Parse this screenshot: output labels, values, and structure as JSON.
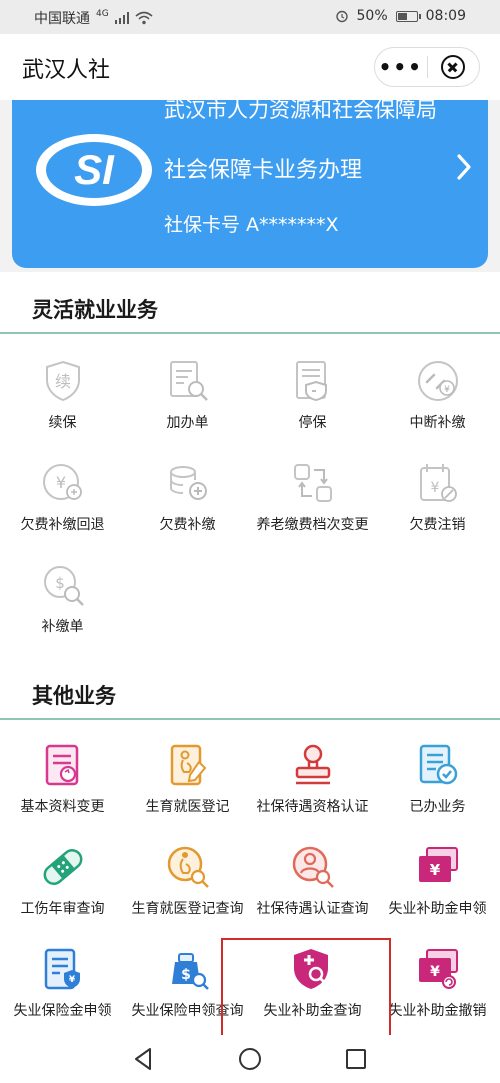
{
  "status_bar": {
    "carrier": "中国联通",
    "network": "4G",
    "battery": "50%",
    "time": "08:09"
  },
  "title_bar": {
    "title": "武汉人社",
    "more_label": "•••"
  },
  "card": {
    "org": "武汉市人力资源和社会保障局",
    "service": "社会保障卡业务办理",
    "card_number": "社保卡号 A*******X",
    "brand_color": "#3d9df0"
  },
  "flexible": {
    "title": "灵活就业业务",
    "items": [
      {
        "label": "续保",
        "icon": "renew-shield-icon"
      },
      {
        "label": "加办单",
        "icon": "form-search-icon"
      },
      {
        "label": "停保",
        "icon": "stop-insurance-doc-icon"
      },
      {
        "label": "中断补缴",
        "icon": "broken-chain-yuan-icon"
      },
      {
        "label": "欠费补缴回退",
        "icon": "yuan-refund-icon"
      },
      {
        "label": "欠费补缴",
        "icon": "coins-add-icon"
      },
      {
        "label": "养老缴费档次变更",
        "icon": "switch-arrows-icon"
      },
      {
        "label": "欠费注销",
        "icon": "calendar-yuan-cancel-icon"
      },
      {
        "label": "补缴单",
        "icon": "dollar-search-icon"
      }
    ]
  },
  "other": {
    "title": "其他业务",
    "items": [
      {
        "label": "基本资料变更",
        "icon": "profile-refresh-icon"
      },
      {
        "label": "生育就医登记",
        "icon": "pregnancy-pen-icon"
      },
      {
        "label": "社保待遇资格认证",
        "icon": "stamp-icon"
      },
      {
        "label": "已办业务",
        "icon": "doc-check-icon"
      },
      {
        "label": "工伤年审查询",
        "icon": "bandage-icon"
      },
      {
        "label": "生育就医登记查询",
        "icon": "pregnancy-search-icon"
      },
      {
        "label": "社保待遇认证查询",
        "icon": "person-search-icon"
      },
      {
        "label": "失业补助金申领",
        "icon": "yuan-cards-icon"
      },
      {
        "label": "失业保险金申领",
        "icon": "yuan-form-icon"
      },
      {
        "label": "失业保险申领查询",
        "icon": "money-bag-search-icon"
      },
      {
        "label": "失业补助金查询",
        "icon": "shield-plus-search-icon"
      },
      {
        "label": "失业补助金撤销",
        "icon": "yuan-cards-undo-icon"
      }
    ]
  },
  "colors": {
    "section_line": "#8ec3b5",
    "highlight": "#d02c2c"
  }
}
